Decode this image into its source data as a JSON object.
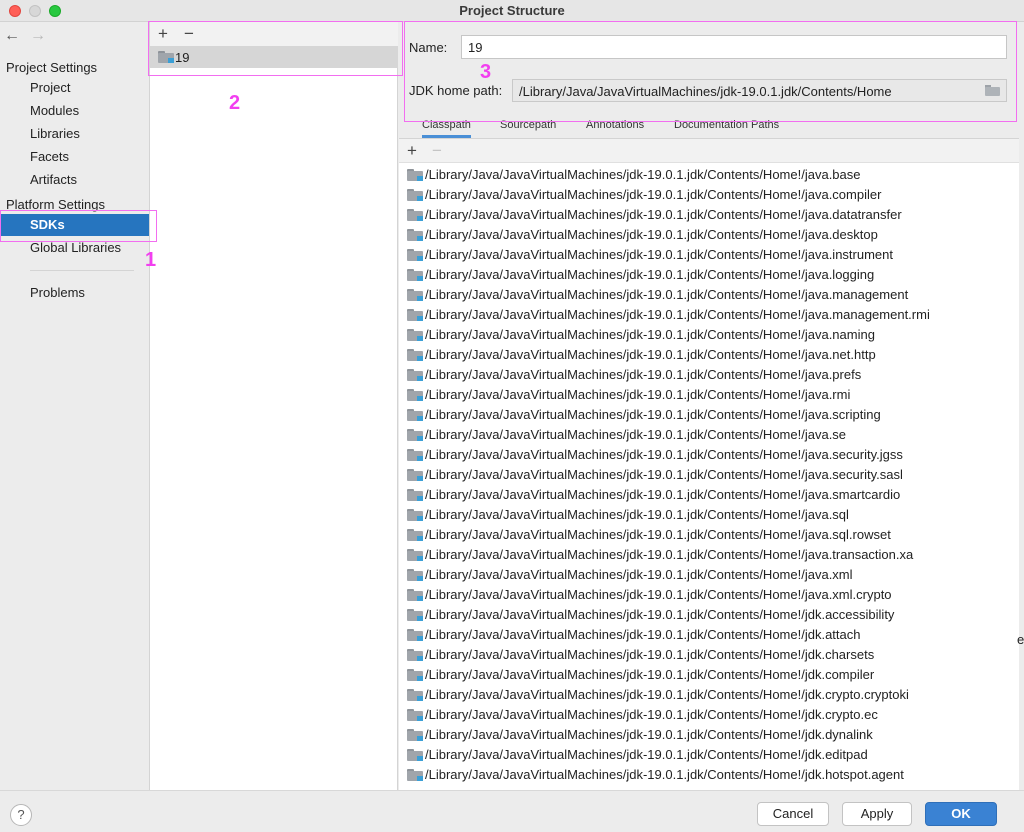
{
  "window": {
    "title": "Project Structure"
  },
  "sidebar": {
    "project_settings_heading": "Project Settings",
    "project_items": [
      "Project",
      "Modules",
      "Libraries",
      "Facets",
      "Artifacts"
    ],
    "platform_settings_heading": "Platform Settings",
    "platform_items": [
      "SDKs",
      "Global Libraries"
    ],
    "selected": "SDKs",
    "problems": "Problems"
  },
  "sdk_list": {
    "add_label": "+",
    "remove_label": "−",
    "items": [
      "19"
    ]
  },
  "detail": {
    "name_label": "Name:",
    "name_value": "19",
    "home_path_label": "JDK home path:",
    "home_path_value": "/Library/Java/JavaVirtualMachines/jdk-19.0.1.jdk/Contents/Home",
    "tabs": [
      "Classpath",
      "Sourcepath",
      "Annotations",
      "Documentation Paths"
    ],
    "active_tab": "Classpath",
    "add_label": "+",
    "remove_label": "−",
    "classpath_prefix": "/Library/Java/JavaVirtualMachines/jdk-19.0.1.jdk/Contents/Home!/",
    "classpath_entries": [
      "java.base",
      "java.compiler",
      "java.datatransfer",
      "java.desktop",
      "java.instrument",
      "java.logging",
      "java.management",
      "java.management.rmi",
      "java.naming",
      "java.net.http",
      "java.prefs",
      "java.rmi",
      "java.scripting",
      "java.se",
      "java.security.jgss",
      "java.security.sasl",
      "java.smartcardio",
      "java.sql",
      "java.sql.rowset",
      "java.transaction.xa",
      "java.xml",
      "java.xml.crypto",
      "jdk.accessibility",
      "jdk.attach",
      "jdk.charsets",
      "jdk.compiler",
      "jdk.crypto.cryptoki",
      "jdk.crypto.ec",
      "jdk.dynalink",
      "jdk.editpad",
      "jdk.hotspot.agent"
    ]
  },
  "annotations": [
    "1",
    "2",
    "3"
  ],
  "edge_char": "e",
  "footer": {
    "help_label": "?",
    "cancel_label": "Cancel",
    "apply_label": "Apply",
    "ok_label": "OK"
  }
}
